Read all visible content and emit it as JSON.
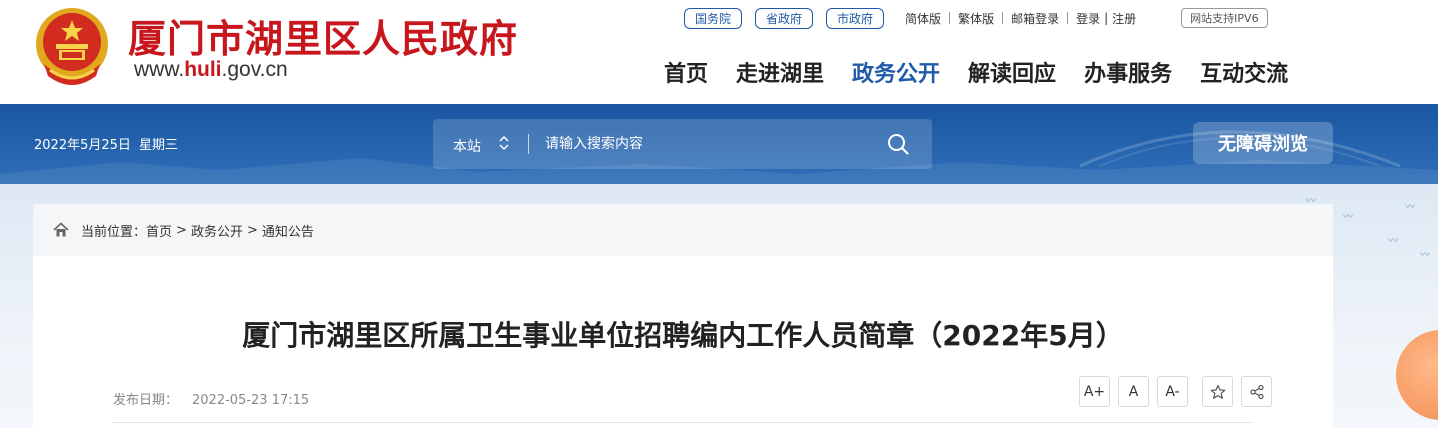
{
  "header": {
    "site_title": "厦门市湖里区人民政府",
    "url_prefix": "www.",
    "url_brand": "huli",
    "url_suffix": ".gov.cn",
    "gov_links": [
      "国务院",
      "省政府",
      "市政府"
    ],
    "utility_links": [
      "简体版",
      "繁体版",
      "邮箱登录",
      "登录",
      "注册"
    ],
    "ipv6": "网站支持IPV6",
    "nav": [
      "首页",
      "走进湖里",
      "政务公开",
      "解读回应",
      "办事服务",
      "互动交流"
    ],
    "active_nav": "政务公开"
  },
  "band": {
    "date": "2022年5月25日",
    "weekday": "星期三",
    "search": {
      "scope": "本站",
      "placeholder": "请输入搜索内容"
    },
    "accessibility_button": "无障碍浏览"
  },
  "breadcrumb": {
    "label": "当前位置：",
    "items": [
      "首页",
      "政务公开",
      "通知公告"
    ],
    "separator": ">"
  },
  "article": {
    "title": "厦门市湖里区所属卫生事业单位招聘编内工作人员简章（2022年5月）",
    "publish_label": "发布日期：",
    "publish_date": "2022-05-23 17:15",
    "tools": {
      "font_increase": "A+",
      "font_default": "A",
      "font_decrease": "A-"
    }
  },
  "colors": {
    "brand_red": "#c8161d",
    "brand_blue": "#1f5aa8",
    "band_blue": "#1a56a2"
  },
  "icons": [
    "national-emblem-icon",
    "chevron-updown-icon",
    "search-icon",
    "home-icon",
    "star-icon",
    "share-icon"
  ]
}
